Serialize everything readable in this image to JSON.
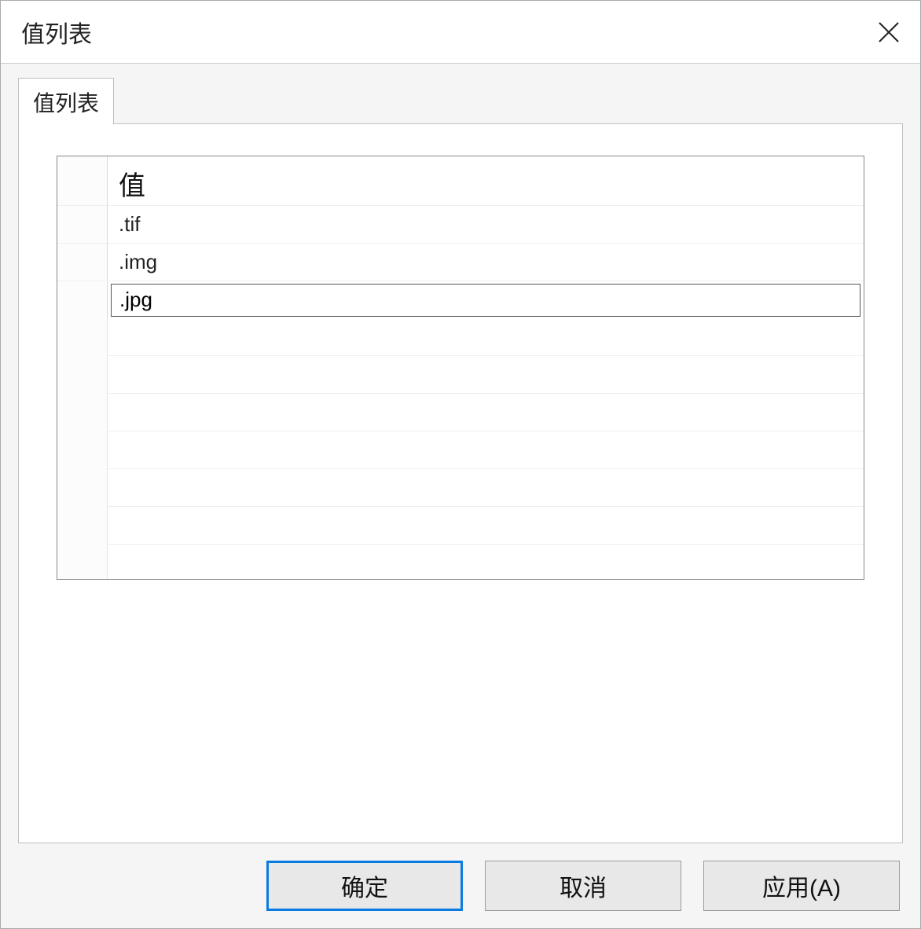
{
  "window": {
    "title": "值列表"
  },
  "tabs": [
    {
      "label": "值列表"
    }
  ],
  "grid": {
    "header": "值",
    "rows": [
      {
        "value": ".tif",
        "editing": false
      },
      {
        "value": ".img",
        "editing": false
      },
      {
        "value": ".jpg",
        "editing": true
      }
    ]
  },
  "buttons": {
    "ok": "确定",
    "cancel": "取消",
    "apply": "应用(A)"
  }
}
